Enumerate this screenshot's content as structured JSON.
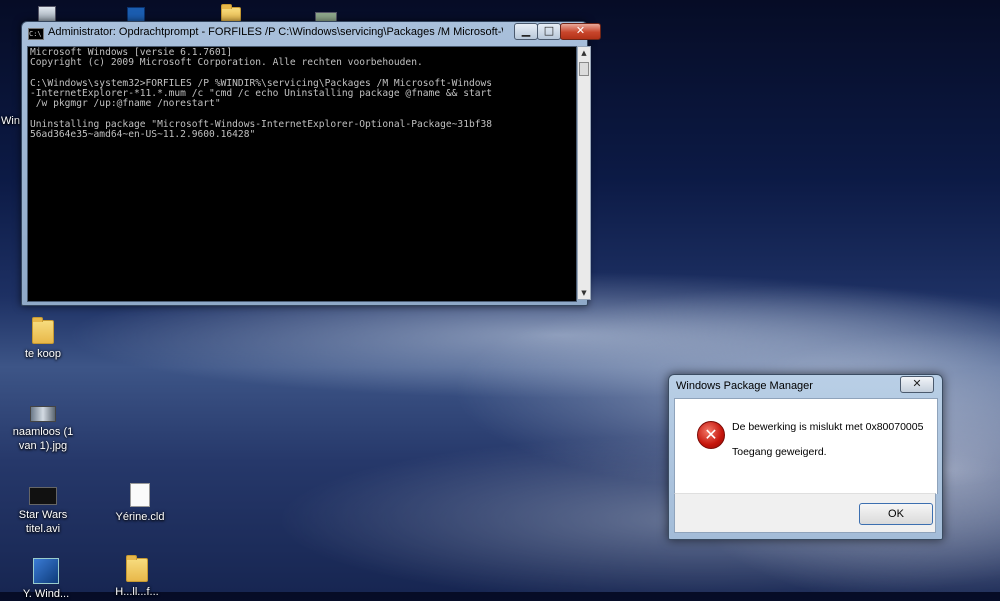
{
  "desktop": {
    "icons": [
      {
        "label": "te koop"
      },
      {
        "label": "naamloos (1 van 1).jpg"
      },
      {
        "label": "Star Wars titel.avi"
      },
      {
        "label": "Yérine.cld"
      },
      {
        "label": "Y. Wind..."
      },
      {
        "label": "H...ll...f..."
      },
      {
        "label": "Win"
      }
    ]
  },
  "console_window": {
    "title": "Administrator: Opdrachtprompt - FORFILES  /P C:\\Windows\\servicing\\Packages /M Microsoft-Win...",
    "buttons": {
      "minimize": "▁",
      "maximize": "□",
      "close": "✕"
    },
    "lines": [
      "Microsoft Windows [versie 6.1.7601]",
      "Copyright (c) 2009 Microsoft Corporation. Alle rechten voorbehouden.",
      "",
      "C:\\Windows\\system32>FORFILES /P %WINDIR%\\servicing\\Packages /M Microsoft-Windows",
      "-InternetExplorer-*11.*.mum /c \"cmd /c echo Uninstalling package @fname && start",
      " /w pkgmgr /up:@fname /norestart\"",
      "",
      "Uninstalling package \"Microsoft-Windows-InternetExplorer-Optional-Package~31bf38",
      "56ad364e35~amd64~en-US~11.2.9600.16428\""
    ]
  },
  "dialog": {
    "title": "Windows Package Manager",
    "close": "✕",
    "error_icon": "error-x-icon",
    "message_line1": "De bewerking is mislukt met 0x80070005",
    "message_line2": "Toegang geweigerd.",
    "ok_label": "OK"
  }
}
